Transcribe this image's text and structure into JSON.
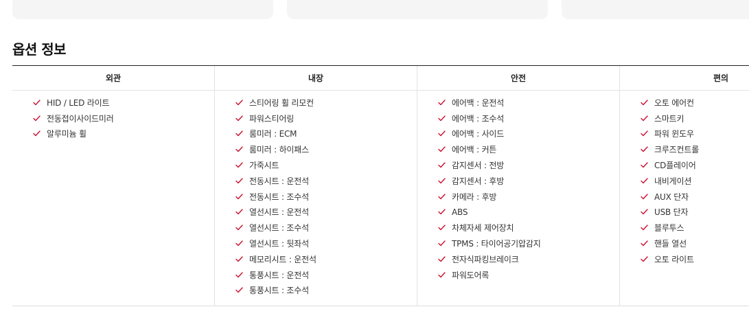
{
  "section": {
    "title": "옵션 정보"
  },
  "colors": {
    "check": "#c8102e",
    "top_card_bg": "#f5f5f6"
  },
  "columns": [
    {
      "header": "외관",
      "items": [
        "HID / LED 라이트",
        "전동접이사이드미러",
        "알루미늄 휠"
      ]
    },
    {
      "header": "내장",
      "items": [
        "스티어링 휠 리모컨",
        "파워스티어링",
        "룸미러 : ECM",
        "룸미러 : 하이패스",
        "가죽시트",
        "전동시트 : 운전석",
        "전동시트 : 조수석",
        "열선시트 : 운전석",
        "열선시트 : 조수석",
        "열선시트 : 뒷좌석",
        "메모리시트 : 운전석",
        "통풍시트 : 운전석",
        "통풍시트 : 조수석"
      ]
    },
    {
      "header": "안전",
      "items": [
        "에어백 : 운전석",
        "에어백 : 조수석",
        "에어백 : 사이드",
        "에어백 : 커튼",
        "감지센서 : 전방",
        "감지센서 : 후방",
        "카메라 : 후방",
        "ABS",
        "차체자세 제어장치",
        "TPMS : 타이어공기압감지",
        "전자식파킹브레이크",
        "파워도어록"
      ]
    },
    {
      "header": "편의",
      "items": [
        "오토 에어컨",
        "스마트키",
        "파워 윈도우",
        "크루즈컨트롤",
        "CD플레이어",
        "내비게이션",
        "AUX 단자",
        "USB 단자",
        "블루투스",
        "핸들 열선",
        "오토 라이트"
      ]
    }
  ]
}
